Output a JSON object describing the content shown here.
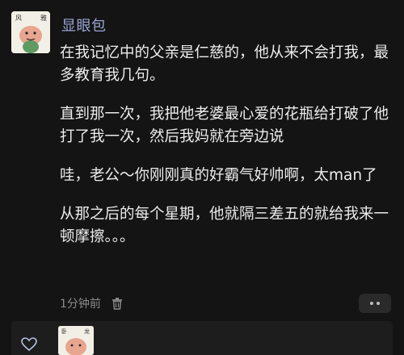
{
  "post": {
    "username": "显眼包",
    "avatar_label": "fan-art-avatar",
    "paragraphs": [
      "在我记忆中的父亲是仁慈的，他从来不会打我，最多教育我几句。",
      "直到那一次，我把他老婆最心爱的花瓶给打破了他打了我一次，然后我妈就在旁边说",
      "哇，老公～你刚刚真的好霸气好帅啊，太man了",
      "从那之后的每个星期，他就隔三差五的就给我来一顿摩擦。。。"
    ],
    "time": "1分钟前",
    "icons": {
      "delete": "trash-icon",
      "more": "more-dots-icon",
      "like": "heart-icon"
    }
  },
  "colors": {
    "background": "#141414",
    "username": "#9aa6d6",
    "text": "#ececec",
    "meta": "#8c8c8c"
  }
}
